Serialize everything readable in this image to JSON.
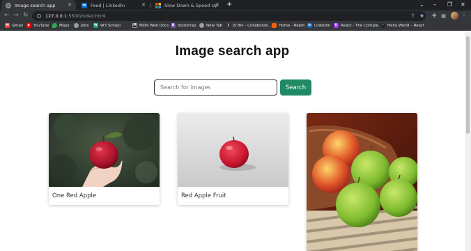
{
  "browser": {
    "tabs": [
      {
        "title": "Image search app",
        "active": true
      },
      {
        "title": "Feed | LinkedIn",
        "active": false
      },
      {
        "title": "Slow Down & Speed Up Video O",
        "active": false
      }
    ],
    "url_host": "127.0.0.1",
    "url_path": ":5500/index.html",
    "bookmarks": [
      {
        "label": "Gmail",
        "icon": "gmail-icon",
        "color": "#ea4335"
      },
      {
        "label": "YouTube",
        "icon": "youtube-icon",
        "color": "#ff0000"
      },
      {
        "label": "Maps",
        "icon": "maps-icon",
        "color": "#34a853"
      },
      {
        "label": "Jobs",
        "icon": "globe-icon",
        "color": "#9aa0a6"
      },
      {
        "label": "W3 School",
        "icon": "w3-icon",
        "color": "#04aa6d"
      },
      {
        "label": "MDN Web Docs",
        "icon": "mdn-icon",
        "color": "#202124"
      },
      {
        "label": "bootstrap",
        "icon": "bootstrap-icon",
        "color": "#7952b3"
      },
      {
        "label": "New Tab",
        "icon": "globe-icon",
        "color": "#9aa0a6"
      },
      {
        "label": "JS Bin - Collaborati...",
        "icon": "jsbin-icon",
        "color": "#333333"
      },
      {
        "label": "Home - Replit",
        "icon": "replit-icon",
        "color": "#f26207"
      },
      {
        "label": "LinkedIn",
        "icon": "linkedin-icon",
        "color": "#0a66c2"
      },
      {
        "label": "React - The Comple...",
        "icon": "udemy-icon",
        "color": "#a435f0"
      },
      {
        "label": "Hello World – React",
        "icon": "react-icon",
        "color": "#61dafb"
      }
    ]
  },
  "app": {
    "title": "Image search app",
    "search": {
      "placeholder": "Search for images",
      "value": ""
    },
    "search_button": "Search",
    "results": [
      {
        "caption": "One Red Apple",
        "image": "red-apple-in-hand-image"
      },
      {
        "caption": "Red Apple Fruit",
        "image": "red-apple-on-gray-image"
      },
      {
        "caption": "",
        "image": "green-apples-in-bowl-image"
      }
    ]
  },
  "colors": {
    "accent": "#1f8a63",
    "chrome_dark": "#202124",
    "chrome": "#35363a"
  }
}
